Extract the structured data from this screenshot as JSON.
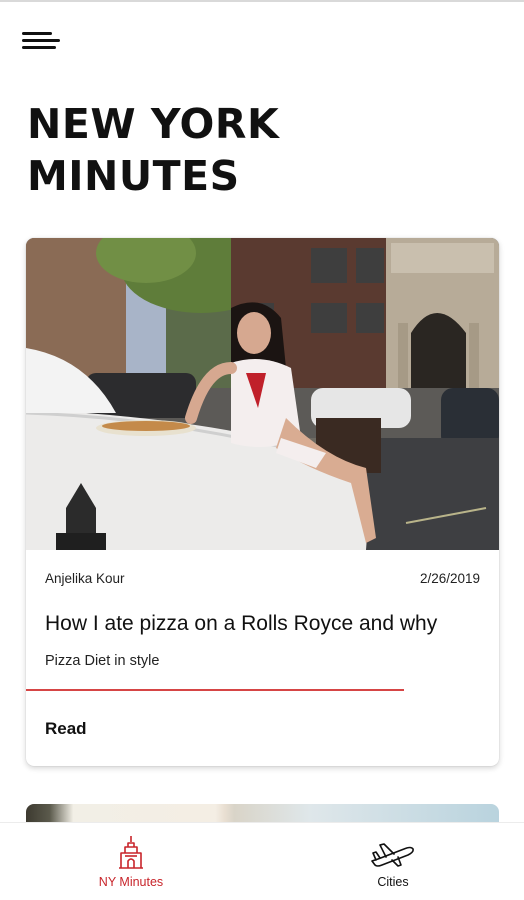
{
  "header": {
    "title": "NEW YORK MINUTES",
    "menu_icon": "hamburger-menu-icon"
  },
  "feed": {
    "cards": [
      {
        "author": "Anjelika Kour",
        "date": "2/26/2019",
        "title": "How I ate pizza on a Rolls Royce and why",
        "subtitle": "Pizza Diet in style",
        "read_label": "Read",
        "progress": 0.8
      }
    ]
  },
  "bottom_nav": {
    "items": [
      {
        "label": "NY Minutes",
        "icon": "empire-state-building-icon",
        "active": true
      },
      {
        "label": "Cities",
        "icon": "airplane-icon",
        "active": false
      }
    ]
  },
  "colors": {
    "accent": "#c8252b",
    "progress": "#d64545",
    "text": "#111111",
    "inactive_nav": "#111111"
  }
}
